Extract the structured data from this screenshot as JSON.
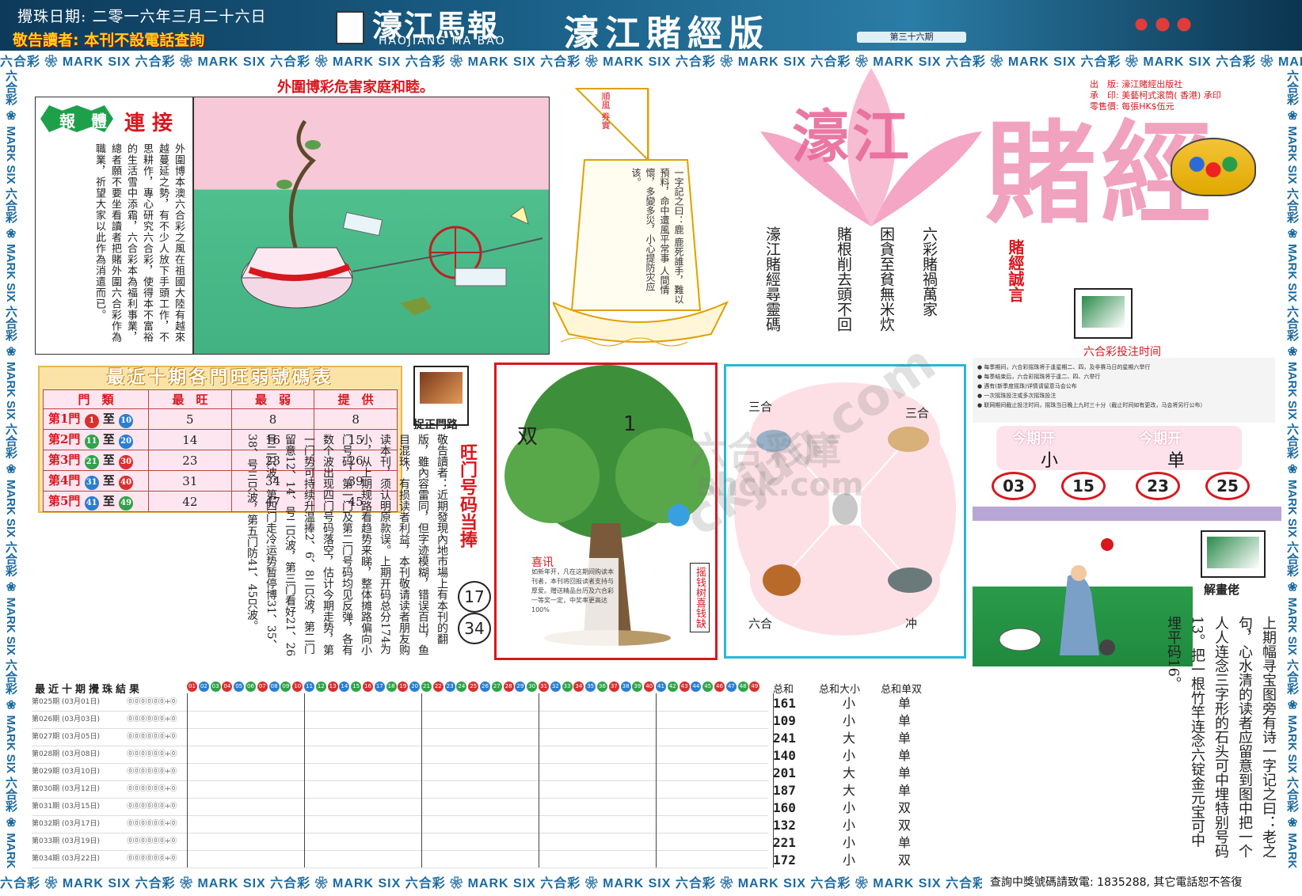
{
  "header": {
    "draw_date": "攪珠日期: 二零一六年三月二十六日",
    "notice": "敬告讀者: 本刊不設電話查詢",
    "logo_cn": "濠江馬報",
    "logo_en": "HAOJIANG MA BAO",
    "edition": "濠江賭經版",
    "issue": "第三十六期"
  },
  "border_text": "六合彩 ❀ MARK SIX 六合彩 ❀ MARK SIX 六合彩 ❀ MARK SIX 六合彩 ❀ MARK SIX 六合彩 ❀ MARK SIX 六合彩 ❀ MARK SIX 六合彩 ❀ MARK SIX 六合彩 ❀ MARK SIX 六合彩 ❀ MARK SIX 六合彩 ❀ MARK SIX 六合彩 ❀ MARK SIX",
  "bottom_hotline": "查詢中獎號碼請致電: 1835288, 其它電話恕不答復",
  "story": {
    "headline": "外圍博彩危害家庭和睦。",
    "tag_part1": "報",
    "tag_part2": "體",
    "tag_part3": "連 接",
    "text": "外圍博本澳六合彩之風在祖國大陸有越來越蔓延之勢，有不少人放下手頭工作，不思耕作，專心研究六合彩，使得本不富裕的生活雪中添霜，六合彩本為福利事業，總者願不要坐看讀者把賭外圍六合彩作為職業，祈望大家以此作為消遣而已。"
  },
  "boat": {
    "flag": "順風 券實",
    "poem": "一字記之曰：鹿 鹿死誰手，難以預料，命中遭風平常事 人間情懷，多變多災，小心提防灾应该。",
    "verses": [
      "六彩賭禍萬家",
      "困貪至貧無米炊",
      "賭根削去頭不回",
      "濠江賭經尋靈碼"
    ]
  },
  "brand": {
    "title_a": "濠江",
    "title_b": "賭經",
    "motto": "賭經誠言",
    "publisher_lines": [
      "出　版: 濠江賭經出版社",
      "承　印: 美藝柯式滚筒( 香港) 承印",
      "零售價: 每張HK$伍元"
    ]
  },
  "mark_six_time": {
    "title": "六合彩投注时间",
    "rules": [
      "● 每季期间，六合彩摇珠将于逢星期二、四，及非赛马日的星期六举行",
      "● 每季结束后，六合彩摇珠将于逢二、四、六举行",
      "● 遇有(新季度摇珠)详情请留意马会公布",
      "● 一次摇珠投注或多次摇珠投注",
      "● 联网期间截止投注时间，摇珠当日晚上九时三十分（截止时间如有更改，马会将另行公布）"
    ],
    "current_labels": [
      "今期开",
      "今期开"
    ],
    "current_values": [
      "小",
      "单"
    ],
    "numbers": [
      "03",
      "15",
      "23",
      "25"
    ]
  },
  "strength_table": {
    "title": "最近十期各門旺弱號碼表",
    "headers": [
      "門　類",
      "最　旺",
      "最　弱",
      "提　供"
    ],
    "rows": [
      {
        "gate": "第1門",
        "from": "1",
        "to": "10",
        "hot": "5",
        "cold": "8",
        "offer": "8",
        "c1": "#d83030",
        "c2": "#2a7ed1"
      },
      {
        "gate": "第2門",
        "from": "11",
        "to": "20",
        "hot": "14",
        "cold": "16",
        "offer": "15",
        "c1": "#2fa34a",
        "c2": "#2a7ed1"
      },
      {
        "gate": "第3門",
        "from": "21",
        "to": "30",
        "hot": "23",
        "cold": "23",
        "offer": "26",
        "c1": "#2fa34a",
        "c2": "#d83030"
      },
      {
        "gate": "第4門",
        "from": "31",
        "to": "40",
        "hot": "31",
        "cold": "34",
        "offer": "39",
        "c1": "#2a7ed1",
        "c2": "#d83030"
      },
      {
        "gate": "第5門",
        "from": "41",
        "to": "49",
        "hot": "42",
        "cold": "47",
        "offer": "45",
        "c1": "#2a7ed1",
        "c2": "#2fa34a"
      }
    ]
  },
  "gate_column": {
    "badge": "捉正門路",
    "intro": "敬告讀者：近期發現內地市場上有本刊的翻版，雖內容雷同，但字迹模糊，错误百出，鱼目混珠，有损读者利益，本刊敬请读者朋友购读本刊，须认明原款误。上期开码总分174为小，从上期规路看趋势来睇，整体摊路偏向小门号码，第一门及第二门号码均见反弹，各有数个波出现四门号码落空，估计今期走势，第一门势可持续升温捧2、6、8二只波，第二门留意12、14、号二只波，第三门看好21、26号二只波，第四门走冷运势暂停博31、35、38、号三只波，第五门防41、45只波。",
    "hot_label": "旺门号码当捧",
    "hot_numbers": [
      "17",
      "34"
    ]
  },
  "tree": {
    "chars": [
      "双",
      "1"
    ],
    "banner": "摇钱树喜钱缺",
    "caption_title": "喜讯",
    "caption": "如新年开，凡在这期间购读本刊者，本刊将回报读者支持与厚爱。赠送精品台历及六合彩 一等奖一定，中奖率更高达100%"
  },
  "zodiac": {
    "labels": [
      "三合",
      "三合",
      "六合",
      "冲"
    ]
  },
  "picture_puzzle": {
    "badge": "解畫佬",
    "text": "上期幅寻宝图旁有诗一字记之曰：老之句，心水清的读者应留意到图中把一个人人连念三字形的石头可中埋特别号码13。把一根竹竿连念六锭金元宝可中埋平码16。"
  },
  "results": {
    "title": "最近十期攪珠結果",
    "draw_labels": [
      "第025期 (03月01日)",
      "第026期 (03月03日)",
      "第027期 (03月05日)",
      "第028期 (03月08日)",
      "第029期 (03月10日)",
      "第030期 (03月12日)",
      "第031期 (03月15日)",
      "第032期 (03月17日)",
      "第033期 (03月19日)",
      "第034期 (03月22日)"
    ],
    "col_headers": [
      "总和",
      "总和大小",
      "总和单双"
    ],
    "sums": [
      "161",
      "109",
      "241",
      "140",
      "201",
      "187",
      "160",
      "132",
      "221",
      "172"
    ],
    "size": [
      "小",
      "小",
      "大",
      "小",
      "大",
      "大",
      "小",
      "小",
      "小",
      "小"
    ],
    "parity": [
      "单",
      "单",
      "单",
      "单",
      "单",
      "单",
      "双",
      "双",
      "单",
      "双"
    ],
    "number_header": [
      "01",
      "02",
      "03",
      "04",
      "05",
      "06",
      "07",
      "08",
      "09",
      "10",
      "11",
      "12",
      "13",
      "14",
      "15",
      "16",
      "17",
      "18",
      "19",
      "20",
      "21",
      "22",
      "23",
      "24",
      "25",
      "26",
      "27",
      "28",
      "29",
      "30",
      "31",
      "32",
      "33",
      "34",
      "35",
      "36",
      "37",
      "38",
      "39",
      "40",
      "41",
      "42",
      "43",
      "44",
      "45",
      "46",
      "47",
      "48",
      "49"
    ]
  },
  "watermarks": [
    "ckjuu.com",
    "六合彩庫",
    "shck.com"
  ]
}
